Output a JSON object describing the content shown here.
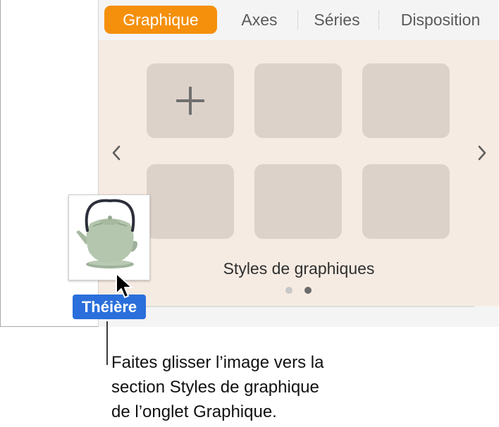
{
  "tabs": [
    {
      "label": "Graphique",
      "active": true
    },
    {
      "label": "Axes",
      "active": false
    },
    {
      "label": "Séries",
      "active": false
    },
    {
      "label": "Disposition",
      "active": false
    }
  ],
  "styles_section": {
    "label": "Styles de graphiques",
    "page_count": 2,
    "current_page": 2
  },
  "dragged_item": {
    "label": "Théière",
    "image": "teapot-photo"
  },
  "callout": {
    "lines": [
      "Faites glisser l’image vers la",
      "section Styles de graphique",
      "de l’onglet Graphique."
    ]
  },
  "colors": {
    "accent_tab": "#f5900c",
    "selection_label": "#2a6fdb",
    "styles_background": "#f6ebe2",
    "tile": "#ddd2ca"
  },
  "icons": [
    "plus-icon",
    "chevron-left-icon",
    "chevron-right-icon",
    "pointer-cursor-icon"
  ]
}
